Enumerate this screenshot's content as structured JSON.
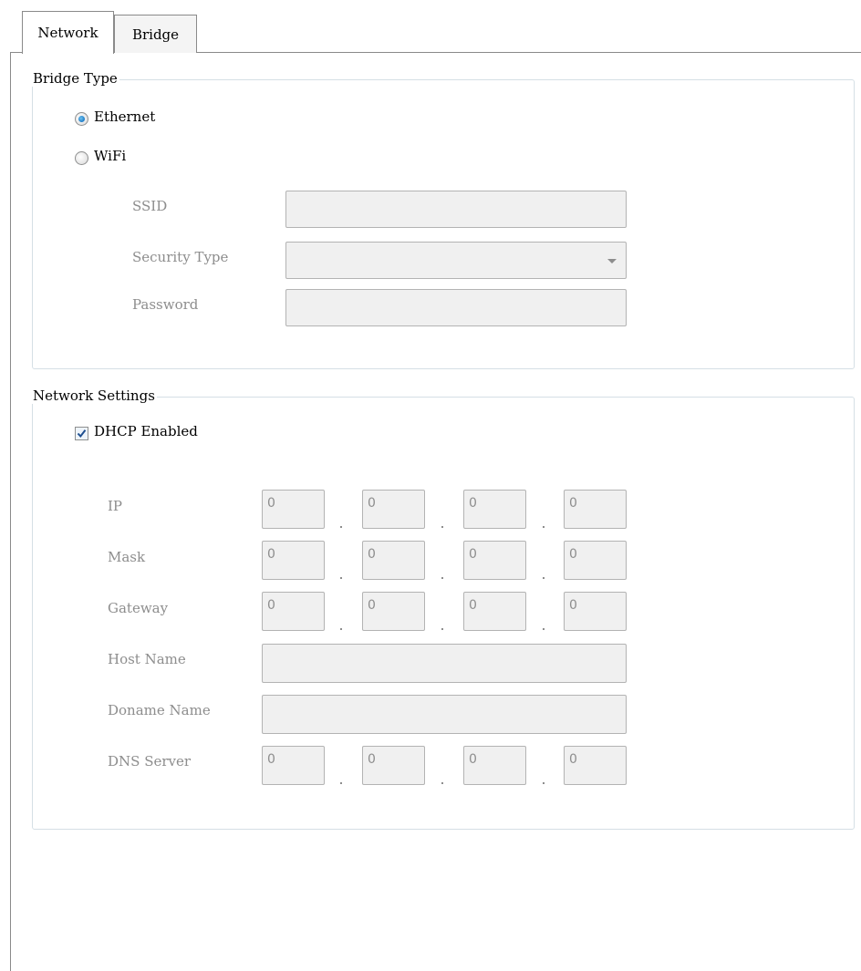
{
  "tabs": [
    {
      "label": "Network",
      "active": true
    },
    {
      "label": "Bridge",
      "active": false
    }
  ],
  "bridge_type": {
    "legend": "Bridge Type",
    "options": [
      {
        "label": "Ethernet",
        "selected": true
      },
      {
        "label": "WiFi",
        "selected": false
      }
    ],
    "wifi": {
      "ssid_label": "SSID",
      "ssid_value": "",
      "security_label": "Security Type",
      "security_value": "",
      "password_label": "Password",
      "password_value": ""
    }
  },
  "network_settings": {
    "legend": "Network Settings",
    "dhcp_label": "DHCP Enabled",
    "dhcp_checked": true,
    "ip_label": "IP",
    "ip": [
      "0",
      "0",
      "0",
      "0"
    ],
    "mask_label": "Mask",
    "mask": [
      "0",
      "0",
      "0",
      "0"
    ],
    "gateway_label": "Gateway",
    "gateway": [
      "0",
      "0",
      "0",
      "0"
    ],
    "host_name_label": "Host Name",
    "host_name": "",
    "doname_label": "Doname Name",
    "doname": "",
    "dns_label": "DNS Server",
    "dns": [
      "0",
      "0",
      "0",
      "0"
    ]
  },
  "colors": {
    "radio_selected": "#1f7bc6",
    "checkbox_check": "#1d4e8f",
    "disabled_text": "#8d8d8d",
    "group_border": "#d5dfe5"
  }
}
